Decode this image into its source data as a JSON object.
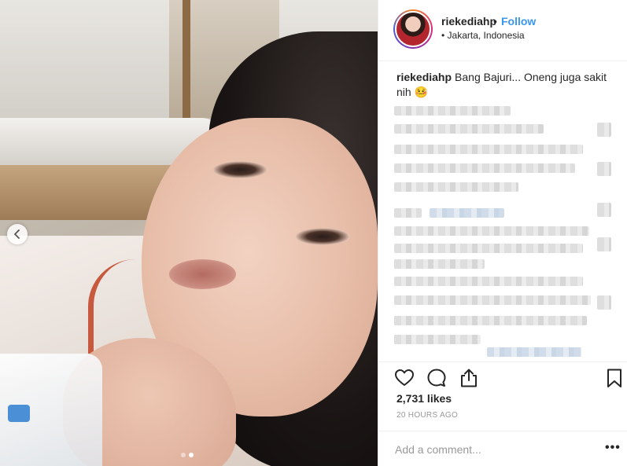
{
  "header": {
    "username": "riekediahp",
    "separator": "•",
    "follow_label": "Follow",
    "location": "• Jakarta, Indonesia"
  },
  "caption": {
    "username": "riekediahp",
    "text": "Bang Bajuri... Oneng juga sakit nih 🤒"
  },
  "carousel": {
    "total": 2,
    "active_index": 2
  },
  "icons": {
    "prev": "chevron-left-icon",
    "like": "heart-icon",
    "comment": "comment-icon",
    "share": "share-icon",
    "save": "bookmark-icon",
    "more": "more-options-icon"
  },
  "stats": {
    "likes": "2,731 likes",
    "time": "20 HOURS AGO"
  },
  "comment": {
    "placeholder": "Add a comment...",
    "more_label": "•••"
  },
  "colors": {
    "accent": "#3897f0",
    "text": "#262626",
    "muted": "#999999",
    "border": "#efefef"
  }
}
